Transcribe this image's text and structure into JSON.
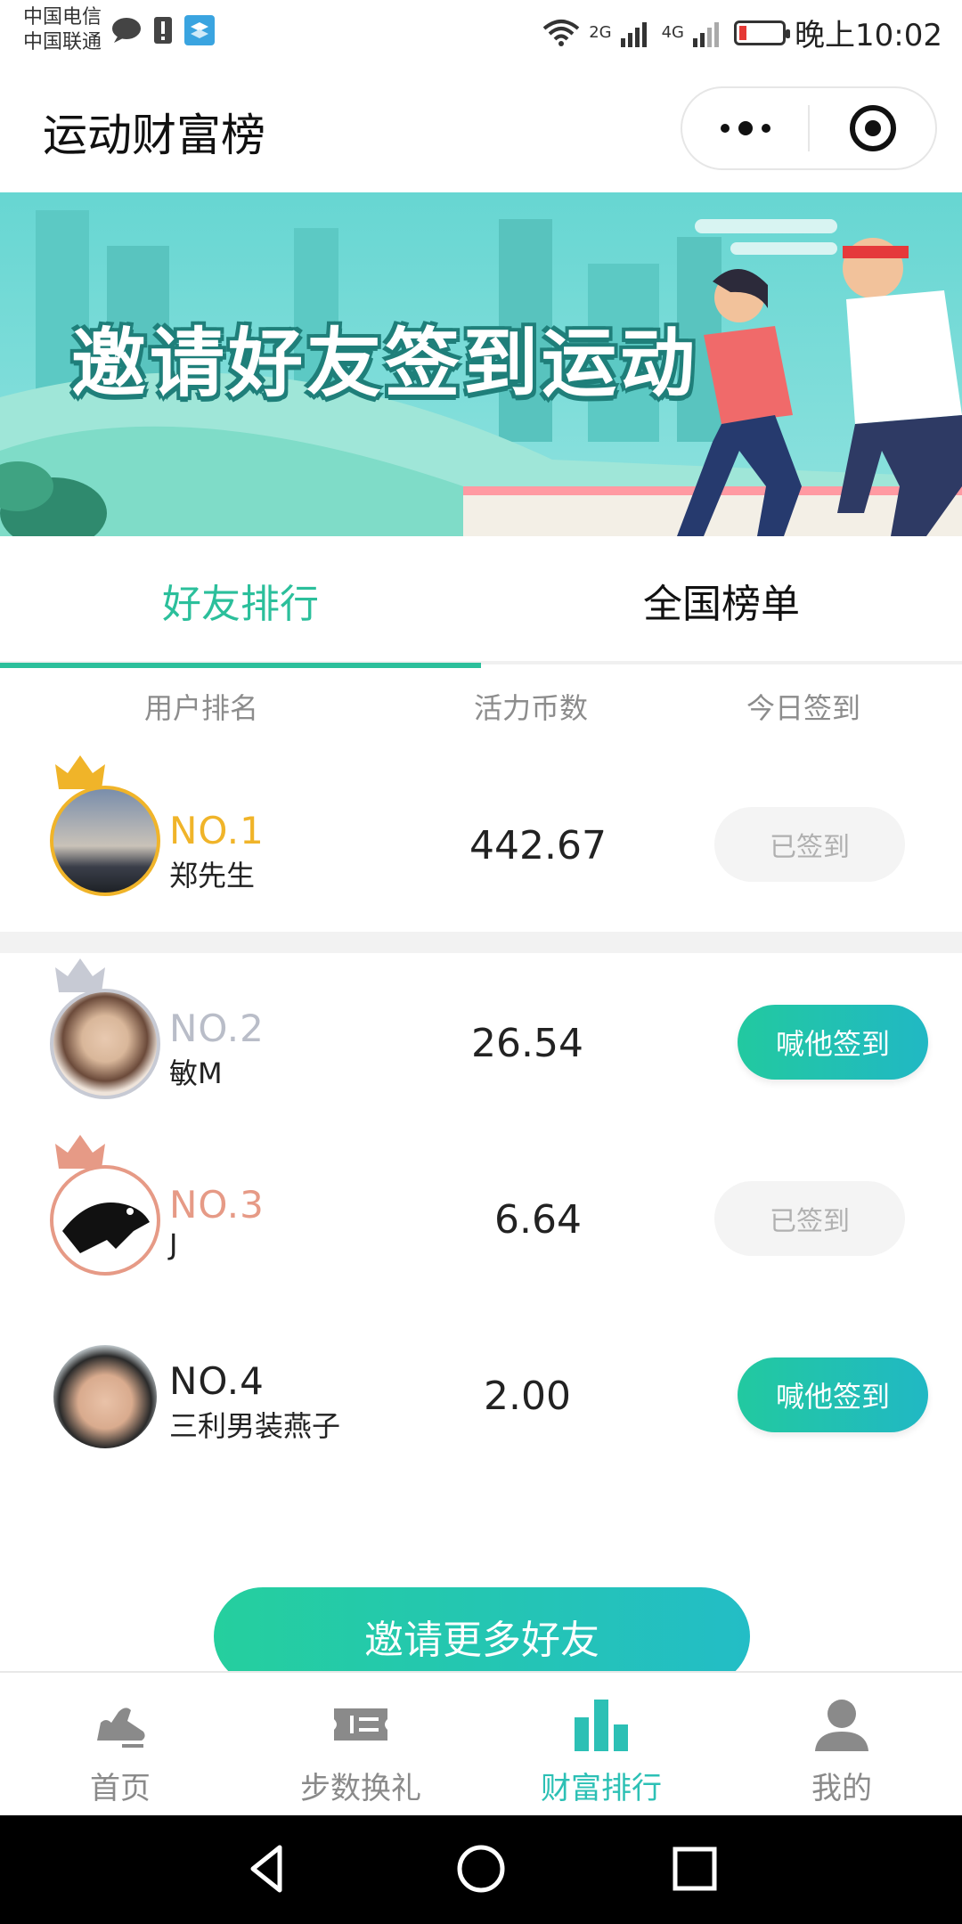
{
  "statusbar": {
    "carrier1": "中国电信",
    "carrier2": "中国联通",
    "net1": "2G",
    "net2": "4G",
    "time": "晚上10:02"
  },
  "titlebar": {
    "title": "运动财富榜"
  },
  "banner": {
    "headline": "邀请好友签到运动"
  },
  "tabs": [
    {
      "label": "好友排行",
      "active": true
    },
    {
      "label": "全国榜单",
      "active": false
    }
  ],
  "table": {
    "headers": [
      "用户排名",
      "活力币数",
      "今日签到"
    ],
    "rows": [
      {
        "rank": "NO.1",
        "name": "郑先生",
        "coins": "442.67",
        "action": "已签到",
        "signed": true
      },
      {
        "rank": "NO.2",
        "name": "敏M",
        "coins": "26.54",
        "action": "喊他签到",
        "signed": false
      },
      {
        "rank": "NO.3",
        "name": "J",
        "coins": "6.64",
        "action": "已签到",
        "signed": true
      },
      {
        "rank": "NO.4",
        "name": "三利男装燕子",
        "coins": "2.00",
        "action": "喊他签到",
        "signed": false
      }
    ]
  },
  "invite": {
    "label": "邀请更多好友"
  },
  "bottomnav": [
    {
      "label": "首页",
      "icon": "shoe-icon"
    },
    {
      "label": "步数换礼",
      "icon": "ticket-icon"
    },
    {
      "label": "财富排行",
      "icon": "bar-chart-icon",
      "active": true
    },
    {
      "label": "我的",
      "icon": "person-icon"
    }
  ],
  "colors": {
    "accent": "#2bbf9b",
    "gold": "#f0b429",
    "silver": "#b9bdc8",
    "bronze": "#e69a86"
  }
}
